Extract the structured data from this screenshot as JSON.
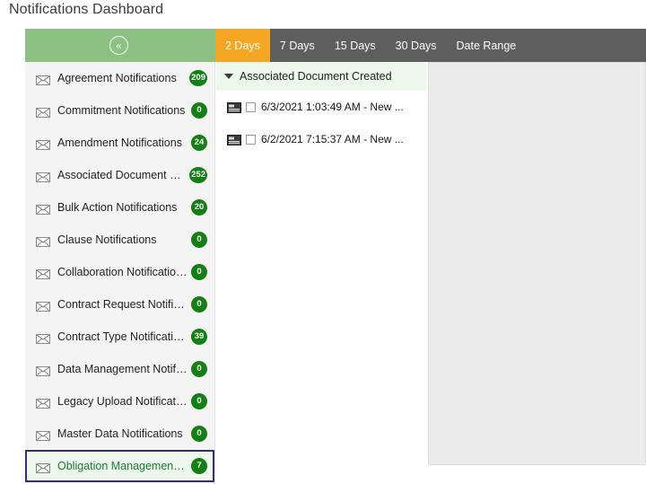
{
  "page": {
    "title": "Notifications Dashboard"
  },
  "toolbar": {
    "collapse_icon": "«",
    "collapse_name": "collapse-panel-button",
    "tabs": [
      {
        "label": "2 Days",
        "active": true
      },
      {
        "label": "7 Days",
        "active": false
      },
      {
        "label": "15 Days",
        "active": false
      },
      {
        "label": "30 Days",
        "active": false
      },
      {
        "label": "Date Range",
        "active": false
      }
    ],
    "active_tab": "2 Days"
  },
  "sidebar": {
    "items": [
      {
        "label": "Agreement Notifications",
        "count": "209",
        "icon": "envelope-icon",
        "selected": false
      },
      {
        "label": "Commitment Notifications",
        "count": "0",
        "icon": "envelope-icon",
        "selected": false
      },
      {
        "label": "Amendment Notifications",
        "count": "24",
        "icon": "envelope-icon",
        "selected": false
      },
      {
        "label": "Associated Document No...",
        "count": "252",
        "icon": "envelope-icon",
        "selected": false
      },
      {
        "label": "Bulk Action Notifications",
        "count": "20",
        "icon": "envelope-icon",
        "selected": false
      },
      {
        "label": "Clause Notifications",
        "count": "0",
        "icon": "envelope-icon",
        "selected": false
      },
      {
        "label": "Collaboration Notifications",
        "count": "0",
        "icon": "envelope-icon",
        "selected": false
      },
      {
        "label": "Contract Request Notifica...",
        "count": "0",
        "icon": "envelope-icon",
        "selected": false
      },
      {
        "label": "Contract Type Notifications",
        "count": "39",
        "icon": "envelope-icon",
        "selected": false
      },
      {
        "label": "Data Management Notifi...",
        "count": "0",
        "icon": "envelope-icon",
        "selected": false
      },
      {
        "label": "Legacy Upload Notificatio...",
        "count": "0",
        "icon": "envelope-icon",
        "selected": false
      },
      {
        "label": "Master Data Notifications",
        "count": "0",
        "icon": "envelope-icon",
        "selected": false
      },
      {
        "label": "Obligation Management ...",
        "count": "7",
        "icon": "envelope-icon",
        "selected": true
      }
    ]
  },
  "tree": {
    "group": {
      "label": "Associated Document Created",
      "expanded": true,
      "toggle_icon": "triangle-down-icon"
    },
    "items": [
      {
        "label": "6/3/2021 1:03:49 AM - New ...",
        "checked": false,
        "icon": "document-icon"
      },
      {
        "label": "6/2/2021 7:15:37 AM - New ...",
        "checked": false,
        "icon": "document-icon"
      }
    ]
  },
  "detail": {
    "content": ""
  },
  "colors": {
    "header_green": "#8cc183",
    "tab_bar_gray": "#5e5e5e",
    "active_tab_orange": "#f5a623",
    "badge_green": "#128012",
    "selected_border": "#3b2a7a",
    "selected_bg": "#eef7ec",
    "selected_text": "#1d7a35",
    "sidebar_bg": "#f4f4f4",
    "detail_bg": "#ebebeb"
  }
}
